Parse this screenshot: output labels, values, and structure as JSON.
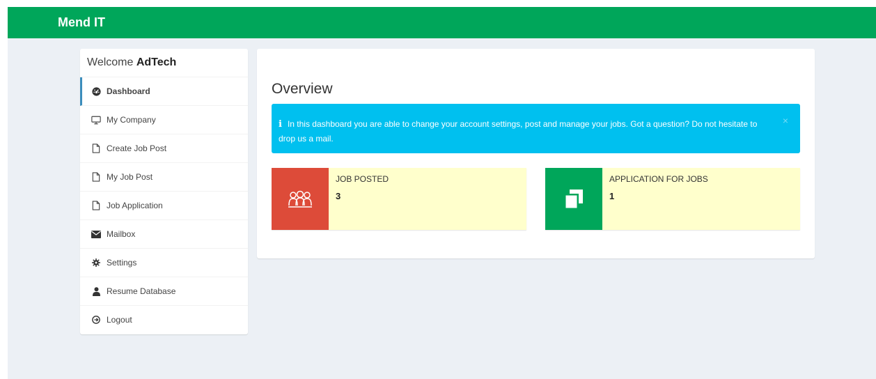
{
  "brand": "Mend IT",
  "sidebar": {
    "welcome_prefix": "Welcome",
    "user_name": "AdTech",
    "items": [
      {
        "label": "Dashboard",
        "icon": "dashboard-icon"
      },
      {
        "label": "My Company",
        "icon": "monitor-icon"
      },
      {
        "label": "Create Job Post",
        "icon": "file-icon"
      },
      {
        "label": "My Job Post",
        "icon": "file-icon"
      },
      {
        "label": "Job Application",
        "icon": "file-icon"
      },
      {
        "label": "Mailbox",
        "icon": "envelope-icon"
      },
      {
        "label": "Settings",
        "icon": "gear-icon"
      },
      {
        "label": "Resume Database",
        "icon": "user-icon"
      },
      {
        "label": "Logout",
        "icon": "logout-icon"
      }
    ]
  },
  "main": {
    "title": "Overview",
    "alert": {
      "icon": "info-icon",
      "text": "In this dashboard you are able to change your account settings, post and manage your jobs. Got a question? Do not hesitate to drop us a mail.",
      "close": "×"
    },
    "stats": [
      {
        "label": "JOB POSTED",
        "value": "3",
        "color": "#dd4b39",
        "icon": "users-icon"
      },
      {
        "label": "APPLICATION FOR JOBS",
        "value": "1",
        "color": "#00a65a",
        "icon": "copy-icon"
      }
    ]
  },
  "colors": {
    "topbar": "#00a65a",
    "alert": "#00c0ef",
    "info_box_bg": "#ffffcc",
    "active_border": "#3c8dbc"
  }
}
